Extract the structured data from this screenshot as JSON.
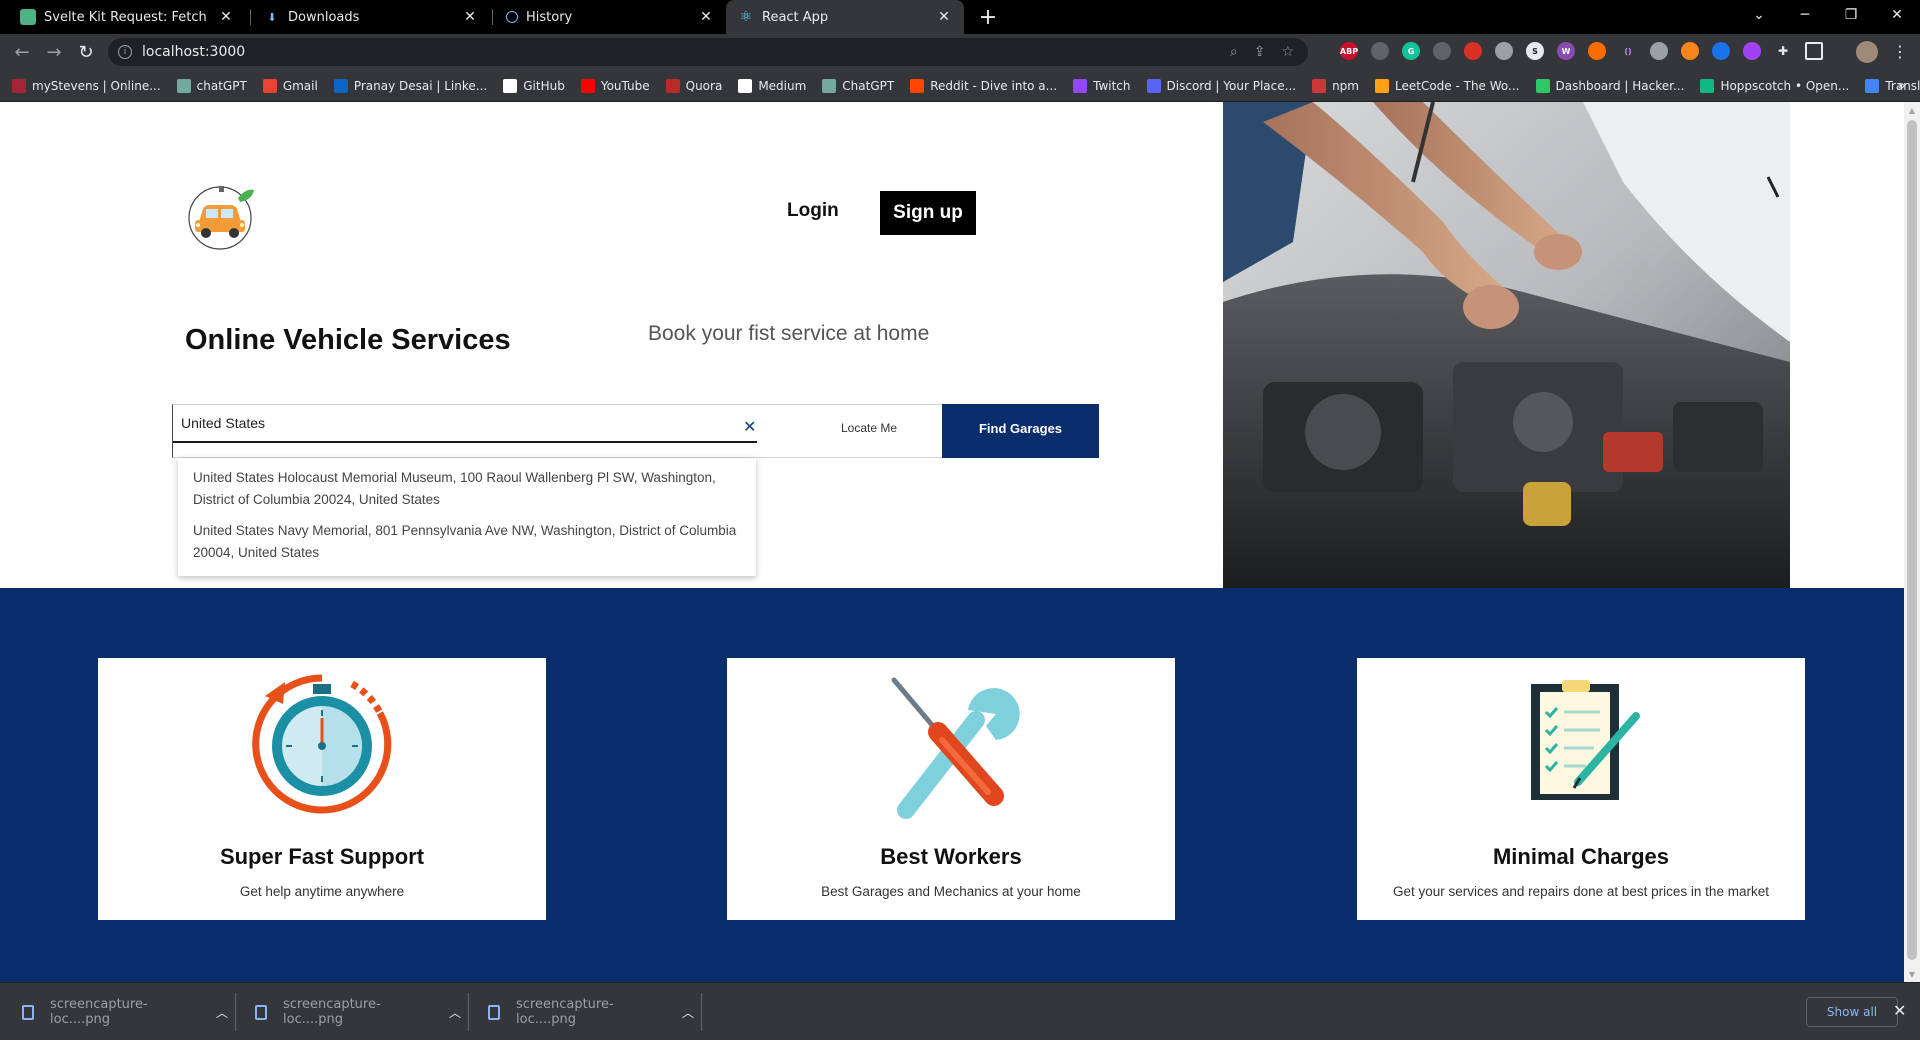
{
  "browser": {
    "tabs": [
      {
        "title": "Svelte Kit Request: Fetch",
        "favicon": "svelte-icon",
        "active": false
      },
      {
        "title": "Downloads",
        "favicon": "download-icon",
        "active": false
      },
      {
        "title": "History",
        "favicon": "history-icon",
        "active": false
      },
      {
        "title": "React App",
        "favicon": "react-icon",
        "active": true
      }
    ],
    "tab_close_glyph": "✕",
    "new_tab_glyph": "+",
    "url": "localhost:3000",
    "bookmarks": [
      {
        "label": "myStevens | Online...",
        "color": "#a32638"
      },
      {
        "label": "chatGPT",
        "color": "#74aa9c"
      },
      {
        "label": "Gmail",
        "color": "#ea4335"
      },
      {
        "label": "Pranay Desai | Linke...",
        "color": "#0a66c2"
      },
      {
        "label": "GitHub",
        "color": "#ffffff"
      },
      {
        "label": "YouTube",
        "color": "#ff0000"
      },
      {
        "label": "Quora",
        "color": "#b92b27"
      },
      {
        "label": "Medium",
        "color": "#ffffff"
      },
      {
        "label": "ChatGPT",
        "color": "#74aa9c"
      },
      {
        "label": "Reddit - Dive into a...",
        "color": "#ff4500"
      },
      {
        "label": "Twitch",
        "color": "#9146ff"
      },
      {
        "label": "Discord | Your Place...",
        "color": "#5865f2"
      },
      {
        "label": "npm",
        "color": "#cb3837"
      },
      {
        "label": "LeetCode - The Wo...",
        "color": "#ffa116"
      },
      {
        "label": "Dashboard | Hacker...",
        "color": "#2ec866"
      },
      {
        "label": "Hoppscotch • Open...",
        "color": "#10b981"
      },
      {
        "label": "Translate",
        "color": "#4285f4"
      }
    ],
    "bookmarks_more": "»"
  },
  "page": {
    "nav": {
      "login_label": "Login",
      "signup_label": "Sign up"
    },
    "headline": "Online Vehicle Services",
    "tagline": "Book your fist service at home",
    "search": {
      "value": "United States ",
      "clear_glyph": "✕",
      "locate_label": "Locate Me",
      "find_label": "Find Garages",
      "suggestions": [
        "United States Holocaust Memorial Museum, 100 Raoul Wallenberg Pl SW, Washington, District of Columbia 20024, United States",
        "United States Navy Memorial, 801 Pennsylvania Ave NW, Washington, District of Columbia 20004, United States"
      ]
    },
    "features": [
      {
        "title": "Super Fast Support",
        "desc": "Get help anytime anywhere",
        "icon": "stopwatch-icon"
      },
      {
        "title": "Best Workers",
        "desc": "Best Garages and Mechanics at your home",
        "icon": "tools-icon"
      },
      {
        "title": "Minimal Charges",
        "desc": "Get your services and repairs done at best prices in the market",
        "icon": "checklist-icon"
      }
    ],
    "colors": {
      "primary_navy": "#0a2e6c",
      "accent_orange": "#e8501a"
    }
  },
  "downloads": {
    "items": [
      {
        "name": "screencapture-loc....png"
      },
      {
        "name": "screencapture-loc....png"
      },
      {
        "name": "screencapture-loc....png"
      }
    ],
    "show_all_label": "Show all",
    "close_glyph": "✕"
  }
}
